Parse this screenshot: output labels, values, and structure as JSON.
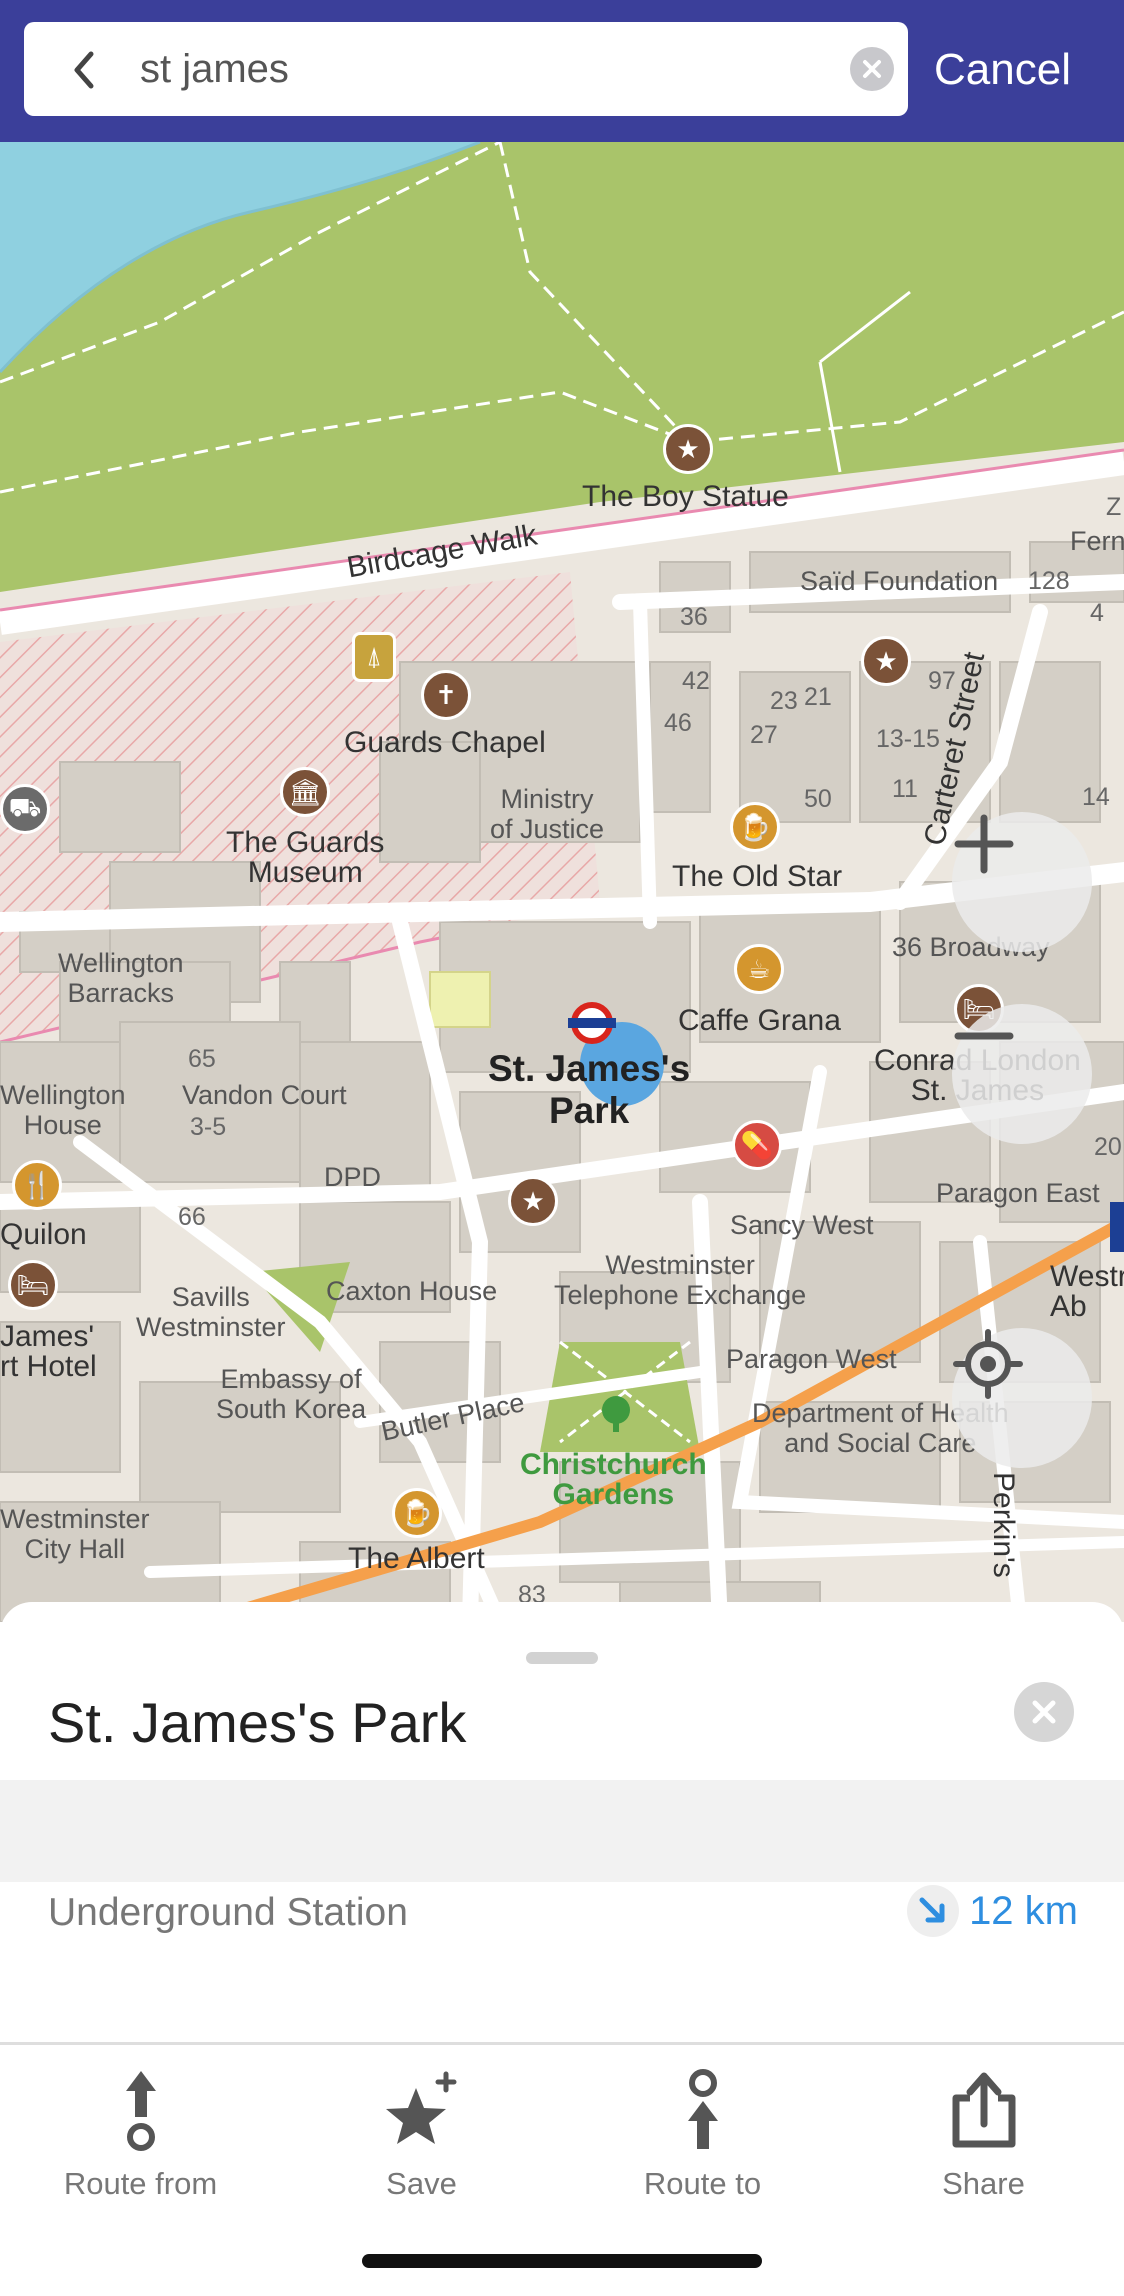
{
  "search": {
    "value": "st james",
    "cancel_label": "Cancel",
    "back_icon": "chevron-left-icon",
    "clear_icon": "clear-icon"
  },
  "map": {
    "labels": {
      "boy_statue": "The Boy Statue",
      "birdcage_walk": "Birdcage Walk",
      "said_foundation": "Saïd Foundation",
      "guards_chapel": "Guards Chapel",
      "ministry": "Ministry\nof Justice",
      "guards_museum": "The Guards\nMuseum",
      "wellington_barracks": "Wellington\nBarracks",
      "old_star": "The Old Star",
      "carteret": "Carteret Street",
      "broadway": "36 Broadway",
      "caffe_grana": "Caffe Grana",
      "conrad": "Conrad London\nSt. James",
      "st_james_park": "St. James's\nPark",
      "wellington_house": "Wellington\nHouse",
      "vandon_court": "Vandon Court",
      "dpd": "DPD",
      "paragon_east": "Paragon East",
      "quilon": "Quilon",
      "sancy_west": "Sancy West",
      "westminster_tel": "Westminster\nTelephone Exchange",
      "caxton_house": "Caxton House",
      "savills": "Savills\nWestminster",
      "james_hotel": "James'\nrt Hotel",
      "paragon_west": "Paragon West",
      "embassy": "Embassy of\nSouth Korea",
      "butler_place": "Butler Place",
      "dept_health": "Department of Health\nand Social Care",
      "christchurch": "Christchurch\nGardens",
      "perkins": "Perkin's",
      "westminster_hall": "Westminster\nCity Hall",
      "the_albert": "The Albert",
      "westr": "Westr\nAb",
      "fern": "Fern",
      "n36": "36",
      "n42": "42",
      "n46": "46",
      "n23": "23",
      "n21": "21",
      "n27": "27",
      "n50": "50",
      "n97": "97",
      "n1315": "13-15",
      "n11": "11",
      "n128": "128",
      "n4": "4",
      "n14": "14",
      "n65": "65",
      "n35": "3-5",
      "n66": "66",
      "n20": "20",
      "n83": "83",
      "nz": "Z"
    }
  },
  "map_controls": {
    "zoom_in_icon": "plus-icon",
    "zoom_out_icon": "minus-icon",
    "locate_icon": "crosshair-icon"
  },
  "place": {
    "title": "St. James's Park",
    "type": "Underground Station",
    "distance": "12 km"
  },
  "actions": [
    {
      "label": "Route from",
      "icon": "route-from-icon"
    },
    {
      "label": "Save",
      "icon": "star-plus-icon"
    },
    {
      "label": "Route to",
      "icon": "route-to-icon"
    },
    {
      "label": "Share",
      "icon": "share-icon"
    }
  ],
  "colors": {
    "header": "#3b3f9a",
    "accent_blue": "#2e8ee0",
    "park_green": "#a9c46a",
    "water": "#8fd0e0",
    "route_orange": "#f5a04b"
  }
}
